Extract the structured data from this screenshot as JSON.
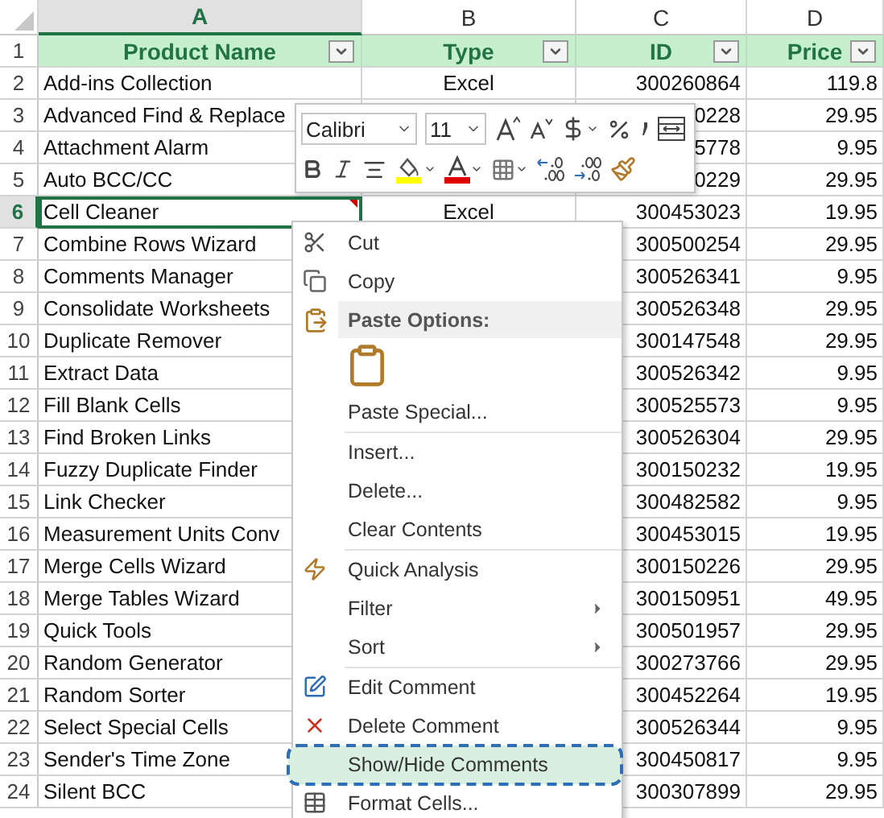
{
  "columns": [
    {
      "letter": "A",
      "selected": true
    },
    {
      "letter": "B",
      "selected": false
    },
    {
      "letter": "C",
      "selected": false
    },
    {
      "letter": "D",
      "selected": false
    }
  ],
  "header_row": {
    "row": "1",
    "labels": [
      "Product Name",
      "Type",
      "ID",
      "Price"
    ]
  },
  "rows": [
    {
      "row": "2",
      "product": "Add-ins Collection",
      "type": "Excel",
      "id": "300260864",
      "price": "119.8",
      "active": false,
      "comment": false
    },
    {
      "row": "3",
      "product": "Advanced Find & Replace",
      "id": "0228",
      "price": "29.95",
      "active": false
    },
    {
      "row": "4",
      "product": "Attachment Alarm",
      "id": "5778",
      "price": "9.95",
      "active": false
    },
    {
      "row": "5",
      "product": "Auto BCC/CC",
      "id": "0229",
      "price": "29.95",
      "active": false
    },
    {
      "row": "6",
      "product": "Cell Cleaner",
      "type": "Excel",
      "id": "300453023",
      "price": "19.95",
      "active": true,
      "comment": true
    },
    {
      "row": "7",
      "product": "Combine Rows Wizard",
      "id": "300500254",
      "price": "29.95",
      "active": false
    },
    {
      "row": "8",
      "product": "Comments Manager",
      "id": "300526341",
      "price": "9.95",
      "active": false
    },
    {
      "row": "9",
      "product": "Consolidate Worksheets",
      "id": "300526348",
      "price": "29.95",
      "active": false
    },
    {
      "row": "10",
      "product": "Duplicate Remover",
      "id": "300147548",
      "price": "29.95",
      "active": false
    },
    {
      "row": "11",
      "product": "Extract Data",
      "id": "300526342",
      "price": "9.95",
      "active": false
    },
    {
      "row": "12",
      "product": "Fill Blank Cells",
      "id": "300525573",
      "price": "9.95",
      "active": false
    },
    {
      "row": "13",
      "product": "Find Broken Links",
      "id": "300526304",
      "price": "29.95",
      "active": false
    },
    {
      "row": "14",
      "product": "Fuzzy Duplicate Finder",
      "id": "300150232",
      "price": "19.95",
      "active": false
    },
    {
      "row": "15",
      "product": "Link Checker",
      "id": "300482582",
      "price": "9.95",
      "active": false
    },
    {
      "row": "16",
      "product": "Measurement Units Conv",
      "id": "300453015",
      "price": "19.95",
      "active": false
    },
    {
      "row": "17",
      "product": "Merge Cells Wizard",
      "id": "300150226",
      "price": "29.95",
      "active": false
    },
    {
      "row": "18",
      "product": "Merge Tables Wizard",
      "id": "300150951",
      "price": "49.95",
      "active": false
    },
    {
      "row": "19",
      "product": "Quick Tools",
      "id": "300501957",
      "price": "29.95",
      "active": false
    },
    {
      "row": "20",
      "product": "Random Generator",
      "id": "300273766",
      "price": "29.95",
      "active": false
    },
    {
      "row": "21",
      "product": "Random Sorter",
      "id": "300452264",
      "price": "19.95",
      "active": false
    },
    {
      "row": "22",
      "product": "Select Special Cells",
      "id": "300526344",
      "price": "9.95",
      "active": false
    },
    {
      "row": "23",
      "product": "Sender's Time Zone",
      "id": "300450817",
      "price": "9.95",
      "active": false
    },
    {
      "row": "24",
      "product": "Silent BCC",
      "id": "300307899",
      "price": "29.95",
      "active": false
    }
  ],
  "mini_toolbar": {
    "font": "Calibri",
    "size": "11"
  },
  "context_menu": {
    "groups": [
      [
        {
          "kind": "item",
          "label": "Cut",
          "submenu": false,
          "selected": false
        },
        {
          "kind": "item",
          "label": "Copy",
          "submenu": false,
          "selected": false
        },
        {
          "kind": "header",
          "label": "Paste Options:"
        },
        {
          "kind": "paste"
        },
        {
          "kind": "item",
          "label": "Paste Special...",
          "submenu": false,
          "selected": false
        }
      ],
      [
        {
          "kind": "item",
          "label": "Insert...",
          "submenu": false,
          "selected": false
        },
        {
          "kind": "item",
          "label": "Delete...",
          "submenu": false,
          "selected": false
        },
        {
          "kind": "item",
          "label": "Clear Contents",
          "submenu": false,
          "selected": false
        }
      ],
      [
        {
          "kind": "item",
          "label": "Quick Analysis",
          "submenu": false,
          "selected": false
        },
        {
          "kind": "item",
          "label": "Filter",
          "submenu": true,
          "selected": false
        },
        {
          "kind": "item",
          "label": "Sort",
          "submenu": true,
          "selected": false
        }
      ],
      [
        {
          "kind": "item",
          "label": "Edit Comment",
          "submenu": false,
          "selected": false
        },
        {
          "kind": "item",
          "label": "Delete Comment",
          "submenu": false,
          "selected": false
        },
        {
          "kind": "item",
          "label": "Show/Hide Comments",
          "submenu": false,
          "selected": true
        },
        {
          "kind": "item",
          "label": "Format Cells...",
          "submenu": false,
          "selected": false
        }
      ]
    ]
  }
}
